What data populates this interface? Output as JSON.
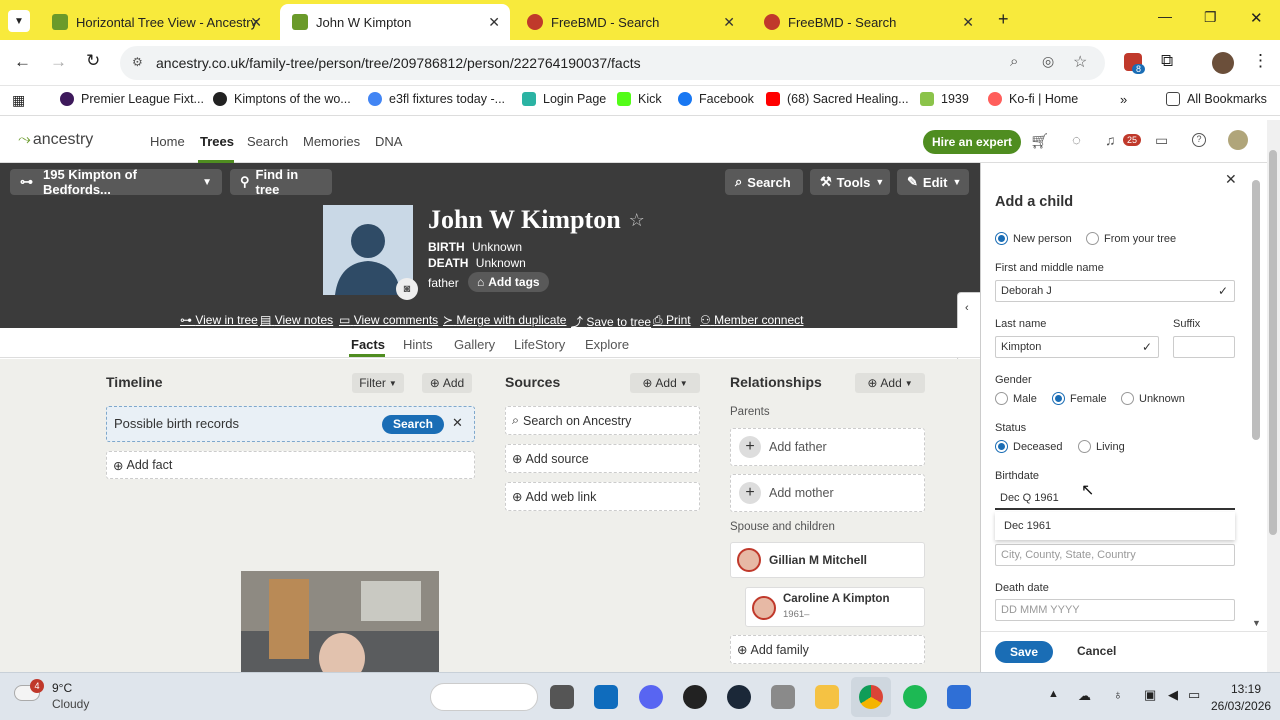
{
  "browser": {
    "tabs": [
      {
        "title": "Horizontal Tree View - Ancestry"
      },
      {
        "title": "John W Kimpton"
      },
      {
        "title": "FreeBMD - Search"
      },
      {
        "title": "FreeBMD - Search"
      }
    ],
    "url": "ancestry.co.uk/family-tree/person/tree/209786812/person/222764190037/facts",
    "extension_badge": "8",
    "bookmarks": [
      "Premier League Fixt...",
      "Kimptons of the wo...",
      "e3fl fixtures today -...",
      "Login Page",
      "Kick",
      "Facebook",
      "(68) Sacred Healing...",
      "1939",
      "Ko-fi | Home"
    ],
    "all_bookmarks": "All Bookmarks"
  },
  "ancestry_nav": {
    "logo": "ancestry",
    "links": [
      "Home",
      "Trees",
      "Search",
      "Memories",
      "DNA"
    ],
    "hire_button": "Hire an expert",
    "notification_count": "25"
  },
  "tree_header": {
    "tree_selector": "195 Kimpton of Bedfords...",
    "find_in_tree": "Find in tree",
    "search": "Search",
    "tools": "Tools",
    "edit": "Edit",
    "person_name": "John W Kimpton",
    "birth_label": "BIRTH",
    "birth_value": "Unknown",
    "death_label": "DEATH",
    "death_value": "Unknown",
    "role": "father",
    "add_tags": "Add tags",
    "actions": [
      "View in tree",
      "View notes",
      "View comments",
      "Merge with duplicate",
      "Save to tree",
      "Print",
      "Member connect"
    ]
  },
  "person_tabs": [
    "Facts",
    "Hints",
    "Gallery",
    "LifeStory",
    "Explore"
  ],
  "timeline": {
    "title": "Timeline",
    "filter": "Filter",
    "add": "Add",
    "possible_birth": "Possible birth records",
    "search_btn": "Search",
    "add_fact": "Add fact"
  },
  "sources": {
    "title": "Sources",
    "add": "Add",
    "search_on_ancestry": "Search on Ancestry",
    "add_source": "Add source",
    "add_web_link": "Add web link"
  },
  "relationships": {
    "title": "Relationships",
    "add": "Add",
    "parents_label": "Parents",
    "add_father": "Add father",
    "add_mother": "Add mother",
    "spouse_label": "Spouse and children",
    "spouse_name": "Gillian M Mitchell",
    "child_name": "Caroline A Kimpton",
    "child_years": "1961–",
    "add_family": "Add family"
  },
  "add_child_panel": {
    "title": "Add a child",
    "new_person": "New person",
    "from_tree": "From your tree",
    "first_name_label": "First and middle name",
    "first_name_value": "Deborah J",
    "last_name_label": "Last name",
    "last_name_value": "Kimpton",
    "suffix_label": "Suffix",
    "gender_label": "Gender",
    "gender_options": [
      "Male",
      "Female",
      "Unknown"
    ],
    "gender_selected": "Female",
    "status_label": "Status",
    "status_options": [
      "Deceased",
      "Living"
    ],
    "status_selected": "Deceased",
    "birthdate_label": "Birthdate",
    "birthdate_value": "Dec Q 1961",
    "birthdate_suggestion": "Dec 1961",
    "birthplace_placeholder": "City, County, State, Country",
    "death_date_label": "Death date",
    "death_date_placeholder": "DD MMM YYYY",
    "save": "Save",
    "cancel": "Cancel"
  },
  "taskbar": {
    "weather_badge": "4",
    "temperature": "9°C",
    "condition": "Cloudy",
    "time": "13:19",
    "date": "26/03/2026"
  },
  "colors": {
    "browser_bar": "#f8ea3c",
    "ancestry_green": "#4f8d20",
    "header_dark": "#3b3b3b",
    "save_blue": "#1a6db5",
    "search_blue": "#1a6db5"
  }
}
